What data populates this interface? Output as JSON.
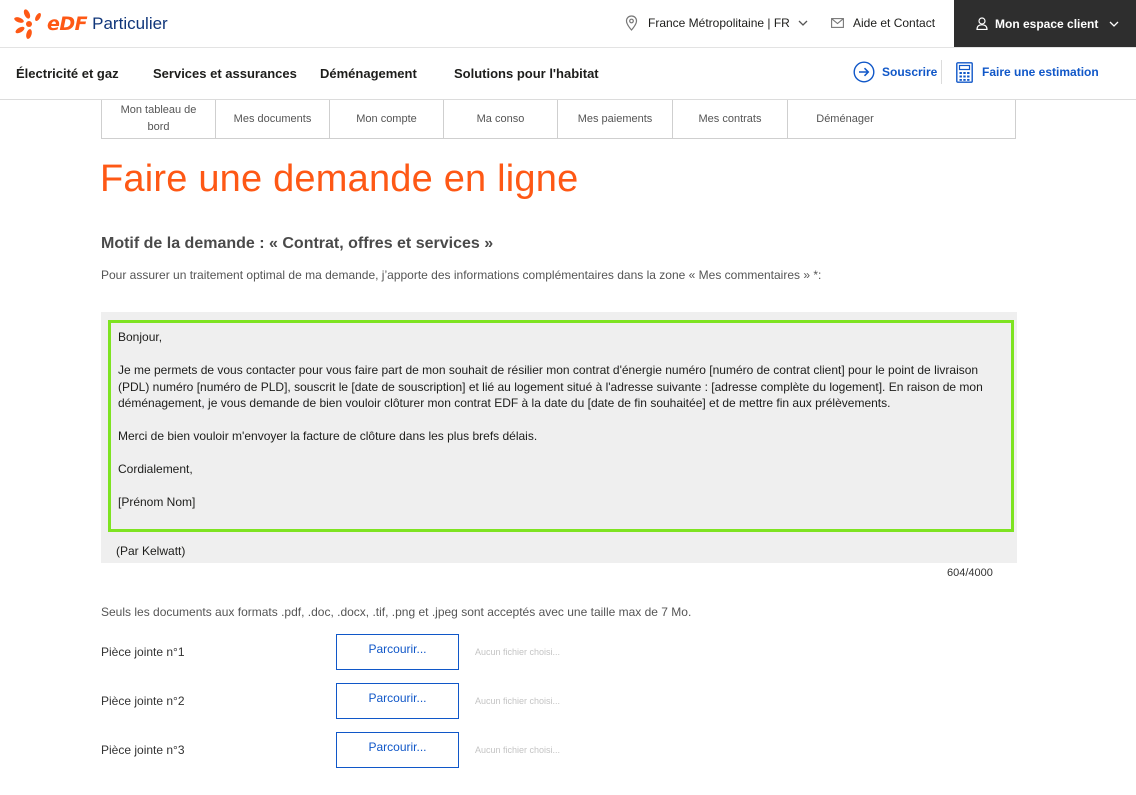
{
  "header": {
    "brand_edf": "eDF",
    "brand_suffix": "Particulier",
    "region": "France Métropolitaine | FR",
    "help": "Aide et Contact",
    "account": "Mon espace client"
  },
  "nav": {
    "items": [
      "Électricité et gaz",
      "Services et assurances",
      "Déménagement",
      "Solutions pour l'habitat"
    ],
    "subscribe": "Souscrire",
    "estimate": "Faire une estimation"
  },
  "tabs": [
    "Mon tableau de bord",
    "Mes documents",
    "Mon compte",
    "Ma conso",
    "Mes paiements",
    "Mes contrats",
    "Déménager"
  ],
  "page": {
    "title": "Faire une demande en ligne",
    "motif": "Motif de la demande : « Contrat, offres et services »",
    "intro": "Pour assurer un traitement optimal de ma demande, j’apporte des informations complémentaires dans la zone « Mes commentaires » *:"
  },
  "comment": {
    "paragraphs": [
      "Bonjour,",
      "Je me permets de vous contacter pour vous faire part de mon souhait de résilier mon contrat d'énergie numéro [numéro de contrat client] pour le point de livraison (PDL) numéro [numéro de PLD], souscrit le [date de souscription] et lié au logement situé à l'adresse suivante : [adresse complète du logement]. En raison de mon déménagement, je vous demande de bien vouloir clôturer mon contrat EDF à la date du [date de fin souhaitée] et de mettre fin aux prélèvements.",
      "Merci de bien vouloir m'envoyer la facture de clôture dans les plus brefs délais.",
      "Cordialement,",
      "[Prénom Nom]"
    ],
    "credit": "(Par Kelwatt)",
    "counter": "604/4000"
  },
  "attachments": {
    "formats_note": "Seuls les documents aux formats .pdf, .doc, .docx, .tif, .png et .jpeg sont acceptés avec une taille max de 7 Mo.",
    "items": [
      {
        "label": "Pièce jointe n°1",
        "button": "Parcourir...",
        "status": "Aucun fichier choisi..."
      },
      {
        "label": "Pièce jointe n°2",
        "button": "Parcourir...",
        "status": "Aucun fichier choisi..."
      },
      {
        "label": "Pièce jointe n°3",
        "button": "Parcourir...",
        "status": "Aucun fichier choisi..."
      }
    ]
  },
  "colors": {
    "brand_orange": "#fe5815",
    "brand_blue": "#1057c8",
    "highlight_green": "#7ee321"
  },
  "icons": [
    "edf-logo-icon",
    "location-pin-icon",
    "chevron-down-icon",
    "envelope-icon",
    "user-icon",
    "arrow-circle-icon",
    "calculator-icon"
  ]
}
